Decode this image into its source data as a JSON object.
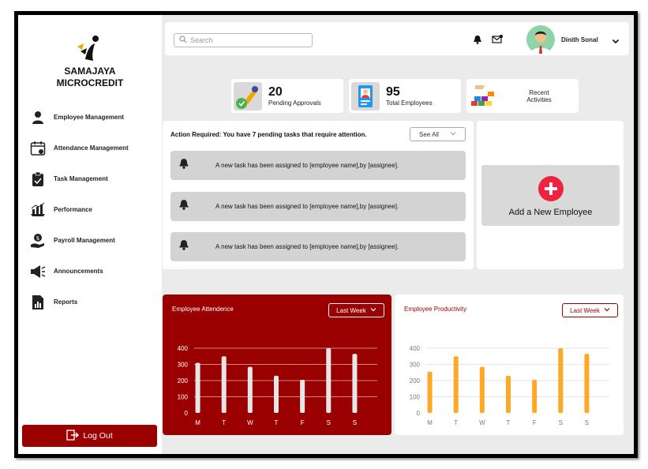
{
  "brand": {
    "line1": "SAMAJAYA",
    "line2": "MICROCREDIT"
  },
  "sidebar": {
    "items": [
      {
        "label": "Employee Management",
        "icon": "person-icon"
      },
      {
        "label": "Attendance Management",
        "icon": "calendar-icon"
      },
      {
        "label": "Task Management",
        "icon": "clipboard-icon"
      },
      {
        "label": "Performance",
        "icon": "chart-icon"
      },
      {
        "label": "Payroll Management",
        "icon": "money-hand-icon"
      },
      {
        "label": "Announcements",
        "icon": "megaphone-icon"
      },
      {
        "label": "Reports",
        "icon": "report-icon"
      }
    ],
    "logout_label": "Log Out"
  },
  "header": {
    "search_placeholder": "Search",
    "user_name": "Dinith Sonal"
  },
  "stats": [
    {
      "value": "20",
      "label": "Pending Approvals",
      "icon": "approval-stamp-icon"
    },
    {
      "value": "95",
      "label": "Total Employees",
      "icon": "id-badge-icon"
    },
    {
      "value": "",
      "label": "Recent Activities",
      "icon": "building-blocks-icon"
    }
  ],
  "actions": {
    "title": "Action Required: You have 7 pending tasks that require attention.",
    "see_all_label": "See All",
    "tasks": [
      "A new task has been assigned to [employee name],by [assignee].",
      "A new task has been assigned to [employee name],by [assignee].",
      "A new task has been assigned to [employee name],by [assignee]."
    ]
  },
  "add_employee": {
    "label": "Add a New Employee"
  },
  "colors": {
    "brand_red": "#9b0000",
    "bar_orange": "#ffa726",
    "add_red": "#f0233f"
  },
  "chart_data": [
    {
      "type": "bar",
      "title": "Employee Attendence",
      "filter_label": "Last Week",
      "categories": [
        "M",
        "T",
        "W",
        "T",
        "F",
        "S",
        "S"
      ],
      "values": [
        310,
        350,
        285,
        230,
        205,
        400,
        365
      ],
      "yticks": [
        0,
        100,
        200,
        300,
        400
      ],
      "ylim": [
        0,
        400
      ],
      "grid": true
    },
    {
      "type": "bar",
      "title": "Employee Productivity",
      "filter_label": "Last Week",
      "categories": [
        "M",
        "T",
        "W",
        "T",
        "F",
        "S",
        "S"
      ],
      "values": [
        255,
        350,
        285,
        230,
        205,
        400,
        365
      ],
      "yticks": [
        0,
        100,
        200,
        300,
        400
      ],
      "ylim": [
        0,
        400
      ],
      "grid": true
    }
  ]
}
